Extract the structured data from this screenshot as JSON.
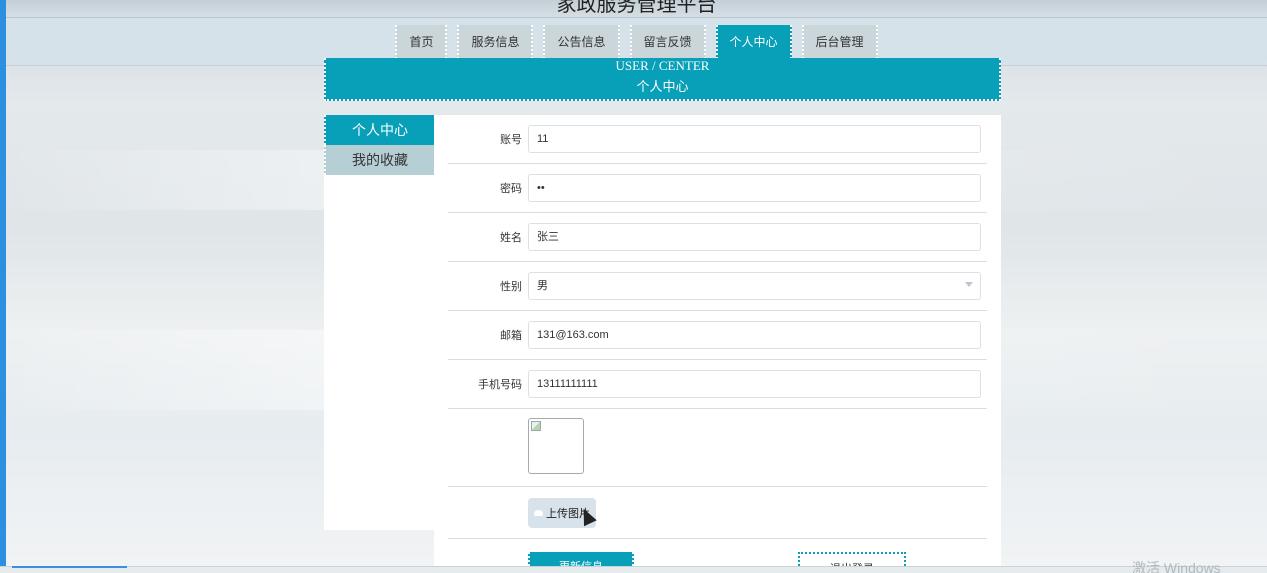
{
  "site": {
    "title": "家政服务管理平台"
  },
  "nav": {
    "items": [
      {
        "label": "首页",
        "active": false
      },
      {
        "label": "服务信息",
        "active": false
      },
      {
        "label": "公告信息",
        "active": false
      },
      {
        "label": "留言反馈",
        "active": false
      },
      {
        "label": "个人中心",
        "active": true
      },
      {
        "label": "后台管理",
        "active": false
      }
    ]
  },
  "banner": {
    "en": "USER / CENTER",
    "cn": "个人中心"
  },
  "side_menu": {
    "items": [
      {
        "label": "个人中心",
        "active": true
      },
      {
        "label": "我的收藏",
        "active": false
      }
    ]
  },
  "form": {
    "account": {
      "label": "账号",
      "value": "11"
    },
    "password": {
      "label": "密码",
      "value": "••"
    },
    "name": {
      "label": "姓名",
      "value": "张三"
    },
    "gender": {
      "label": "性别",
      "value": "男"
    },
    "email": {
      "label": "邮箱",
      "value": "131@163.com"
    },
    "phone": {
      "label": "手机号码",
      "value": "13111111111"
    },
    "upload_label": "上传图片",
    "update_button": "更新信息",
    "logout_button": "退出登录"
  },
  "os": {
    "watermark": "激活 Windows"
  },
  "colors": {
    "accent": "#08a0b8",
    "nav_inactive": "#cbd6da",
    "side_inactive": "#b5cfd5"
  }
}
